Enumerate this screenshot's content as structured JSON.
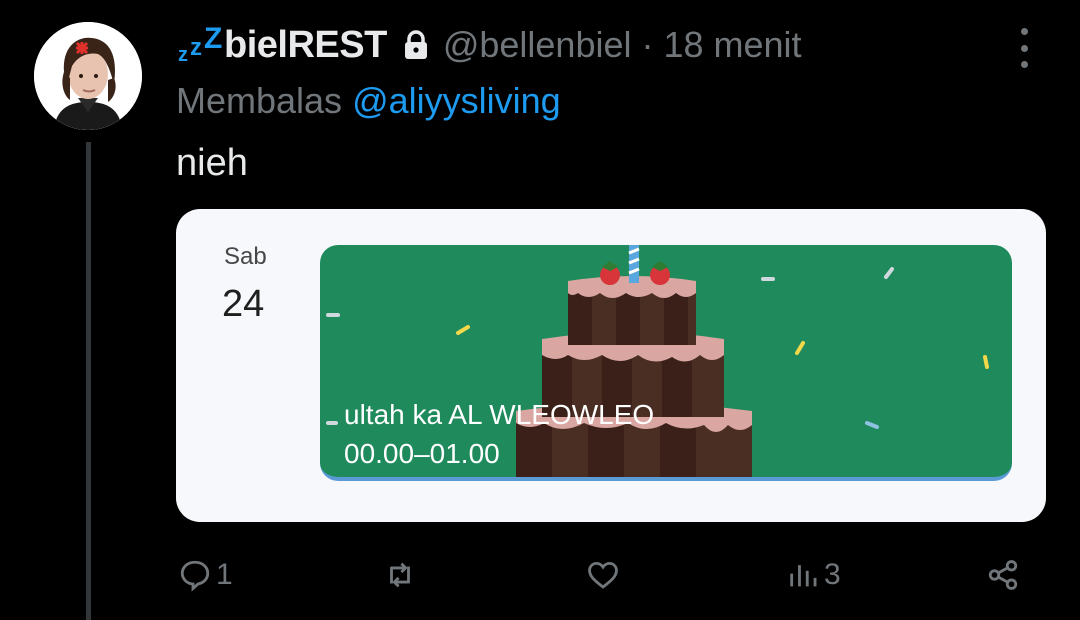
{
  "tweet": {
    "display_name": "bielREST",
    "name_prefix": [
      "z",
      "z",
      "Z"
    ],
    "handle": "@bellenbiel",
    "separator": "·",
    "time": "18 menit",
    "reply_prefix": "Membalas",
    "reply_to": "@aliyysliving",
    "text": "nieh"
  },
  "calendar_card": {
    "day_name": "Sab",
    "day_number": "24",
    "event_title": "ultah ka AL WLEOWLEO",
    "event_time": "00.00–01.00",
    "event_color": "#1f8a5b"
  },
  "actions": {
    "reply_count": "1",
    "retweet_count": "",
    "like_count": "",
    "views_count": "3"
  },
  "colors": {
    "background": "#000000",
    "accent": "#1d9bf0",
    "muted": "#71767b",
    "text": "#e7e9ea"
  },
  "icons": [
    "lock-icon",
    "more-icon",
    "reply-icon",
    "retweet-icon",
    "like-icon",
    "views-icon",
    "share-icon"
  ]
}
